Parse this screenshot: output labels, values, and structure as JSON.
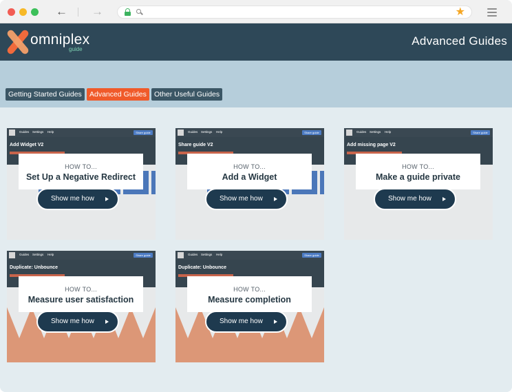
{
  "browser": {
    "url": "",
    "back_icon": "arrow-left-icon",
    "forward_icon": "arrow-right-icon",
    "back_glyph": "←",
    "forward_glyph": "→"
  },
  "header": {
    "brand": "omniplex",
    "brand_sub": "guide",
    "title": "Advanced Guides"
  },
  "tabs": [
    {
      "label": "Getting Started Guides",
      "active": false
    },
    {
      "label": "Advanced Guides",
      "active": true
    },
    {
      "label": "Other Useful Guides",
      "active": false
    }
  ],
  "cards": [
    {
      "howto": "HOW TO...",
      "title": "Set Up a Negative Redirect",
      "button": "Show me how",
      "shot_title": "Add Widget V2",
      "shot": "tiles"
    },
    {
      "howto": "HOW TO...",
      "title": "Add a Widget",
      "button": "Show me how",
      "shot_title": "Share guide V2",
      "shot": "tiles"
    },
    {
      "howto": "HOW TO...",
      "title": "Make a guide private",
      "button": "Show me how",
      "shot_title": "Add missing page V2",
      "shot": "plain"
    },
    {
      "howto": "HOW TO...",
      "title": "Measure user satisfaction",
      "button": "Show me how",
      "shot_title": "Duplicate: Unbounce",
      "shot": "chart"
    },
    {
      "howto": "HOW TO...",
      "title": "Measure completion",
      "button": "Show me how",
      "shot_title": "Duplicate: Unbounce",
      "shot": "chart"
    }
  ],
  "mini_ui": {
    "nav": [
      "Guides",
      "Settings",
      "Help"
    ],
    "button": "Share guide"
  },
  "colors": {
    "header_bg": "#2e4858",
    "tab_active": "#f05a2a",
    "tab_inactive": "#3b5665",
    "button_bg": "#1e3a4f",
    "star": "#f5a623"
  }
}
